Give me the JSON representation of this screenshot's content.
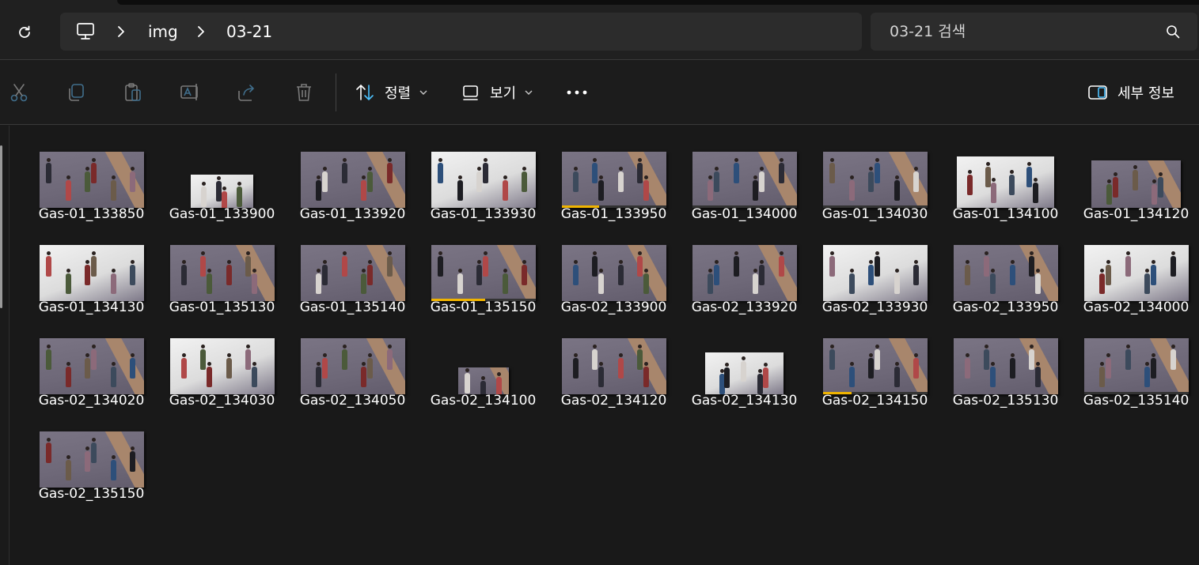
{
  "nav": {
    "breadcrumb": [
      "img",
      "03-21"
    ]
  },
  "search": {
    "placeholder": "03-21 검색"
  },
  "toolbar": {
    "sort_label": "정렬",
    "view_label": "보기",
    "details_label": "세부 정보"
  },
  "icons": [
    "refresh-icon",
    "computer-icon",
    "chevron-right-icon",
    "search-icon",
    "cut-icon",
    "copy-icon",
    "paste-icon",
    "rename-icon",
    "share-icon",
    "delete-icon",
    "sort-icon",
    "view-icon",
    "more-icon",
    "details-pane-icon"
  ],
  "colors": {
    "accent": "#4cc2ff",
    "progress": "#f0b400",
    "floor_dark": "#6e6878",
    "floor_light": "#e6e6e6",
    "stripe": "#a8866c"
  },
  "files": [
    {
      "name": "Gas-01_133850",
      "style": "dark"
    },
    {
      "name": "Gas-01_133900",
      "style": "small-light"
    },
    {
      "name": "Gas-01_133920",
      "style": "dark"
    },
    {
      "name": "Gas-01_133930",
      "style": "light"
    },
    {
      "name": "Gas-01_133950",
      "style": "dark",
      "progress": 0.36
    },
    {
      "name": "Gas-01_134000",
      "style": "dark",
      "progress": 0
    },
    {
      "name": "Gas-01_134030",
      "style": "dark",
      "progress": 0
    },
    {
      "name": "Gas-01_134100",
      "style": "light-narrow"
    },
    {
      "name": "Gas-01_134120",
      "style": "dark-narrow"
    },
    {
      "name": "Gas-01_134130",
      "style": "light"
    },
    {
      "name": "Gas-01_135130",
      "style": "dark"
    },
    {
      "name": "Gas-01_135140",
      "style": "dark"
    },
    {
      "name": "Gas-01_135150",
      "style": "dark",
      "progress": 0.52
    },
    {
      "name": "Gas-02_133900",
      "style": "dark"
    },
    {
      "name": "Gas-02_133920",
      "style": "dark"
    },
    {
      "name": "Gas-02_133930",
      "style": "light"
    },
    {
      "name": "Gas-02_133950",
      "style": "dark"
    },
    {
      "name": "Gas-02_134000",
      "style": "light"
    },
    {
      "name": "Gas-02_134020",
      "style": "dark"
    },
    {
      "name": "Gas-02_134030",
      "style": "light"
    },
    {
      "name": "Gas-02_134050",
      "style": "dark"
    },
    {
      "name": "Gas-02_134100",
      "style": "small-dark"
    },
    {
      "name": "Gas-02_134120",
      "style": "dark"
    },
    {
      "name": "Gas-02_134130",
      "style": "medium-light"
    },
    {
      "name": "Gas-02_134150",
      "style": "dark",
      "progress": 0.28
    },
    {
      "name": "Gas-02_135130",
      "style": "dark"
    },
    {
      "name": "Gas-02_135140",
      "style": "dark",
      "progress": 0
    },
    {
      "name": "Gas-02_135150",
      "style": "dark"
    }
  ]
}
